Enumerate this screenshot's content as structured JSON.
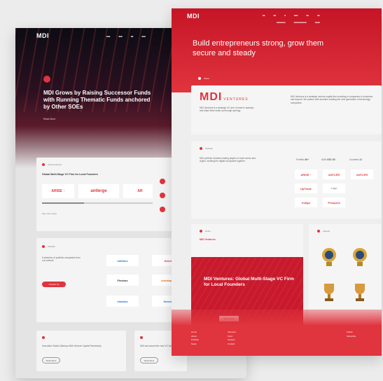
{
  "back": {
    "hero_title": "MDI Grows by Raising Successor Funds with Running Thematic Funds anchored by Other SOEs",
    "hero_sub": "Read More",
    "card1_tag": "Announcement",
    "card1_title": "Global Multi-Stage VC Firm for Local Founders",
    "logos": [
      "ARISE ↑",
      "antlerge",
      "AR"
    ],
    "card1_link": "See more news",
    "card2_tag": "Portfolio",
    "card2_text": "A selection of portfolio companies from our network",
    "card2_btn": "Contact Us",
    "portfolio": [
      "halftime",
      "ticket",
      "Flexbox",
      "bukalapak",
      "kitabisa",
      "fintech"
    ],
    "news1": "Innovation Studio Startups With Venture Capital Partnership",
    "news2": "MDI announced the new VC funds",
    "read_btn": "Read More"
  },
  "front": {
    "tagline": "Build entrepreneurs strong, grow them secure and steady",
    "about_tag": "About",
    "brand": "MDI",
    "brand_suffix": "VENTURES",
    "brand_para": "MDI Ventures is a strategic VC arm. Invests in startups and helps them scale up through synergy.",
    "about_para": "MDI Ventures is a strategic venture capital firm investing in companies in Indonesia and beyond. We partner with founders building the next generation of technology companies.",
    "portfolio_tag": "Portfolio",
    "portfolio_para": "MDI portfolio includes leading players in each sector and region, building the digital ecosystem together.",
    "stats": [
      {
        "label": "Portfolio",
        "value": "80+"
      },
      {
        "label": "AUM",
        "value": "USD 1B"
      },
      {
        "label": "Countries",
        "value": "12"
      }
    ],
    "logos": [
      "ARISE ↑",
      "ANTLER",
      "ANTLER",
      "UpTrade",
      "Logo",
      "Indigo",
      "Prospera"
    ],
    "news_tag": "News",
    "news_title": "MDI Ventures",
    "promo_title": "MDI Ventures: Global Multi-Stage VC Firm for Local Founders",
    "promo_btn": "Read More",
    "awards_tag": "Awards",
    "footer_cols": [
      [
        "Home",
        "About",
        "Portfolio",
        "News"
      ],
      [
        "Ventures",
        "Fund",
        "Careers",
        "Contact"
      ]
    ],
    "footer_right": [
      "Follow",
      "Subscribe"
    ]
  }
}
